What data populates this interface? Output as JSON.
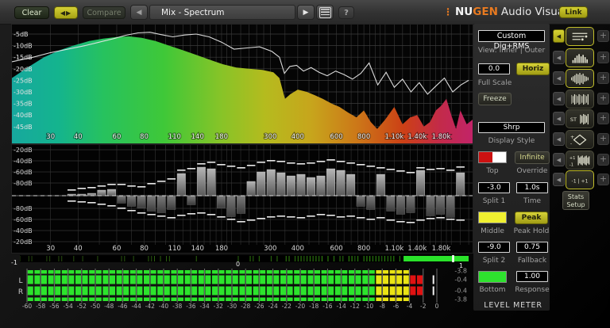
{
  "toolbar": {
    "clear": "Clear",
    "swap_icon": "◀▶",
    "compare": "Compare",
    "prev_icon": "◀",
    "preset": "Mix - Spectrum",
    "play_icon": "▶",
    "help": "?",
    "brand": {
      "dots": "⋮",
      "nu": "NU",
      "gen": "GEN",
      "rest": "Audio Visualizer"
    },
    "link": "Link"
  },
  "colors": {
    "accent_yellow": "#c8c428",
    "brand_orange": "#e87a20"
  },
  "spectrum": {
    "fmin": 20,
    "fmax": 2500,
    "y_labels": [
      "-5dB",
      "-10dB",
      "-15dB",
      "-20dB",
      "-25dB",
      "-30dB",
      "-35dB",
      "-40dB",
      "-45dB"
    ],
    "x_labels": [
      [
        30,
        "30"
      ],
      [
        40,
        "40"
      ],
      [
        60,
        "60"
      ],
      [
        80,
        "80"
      ],
      [
        110,
        "110"
      ],
      [
        140,
        "140"
      ],
      [
        180,
        "180"
      ],
      [
        300,
        "300"
      ],
      [
        400,
        "400"
      ],
      [
        600,
        "600"
      ],
      [
        800,
        "800"
      ],
      [
        1100,
        "1.10k"
      ],
      [
        1400,
        "1.40k"
      ],
      [
        1800,
        "1.80k"
      ]
    ],
    "grid_freqs": [
      30,
      40,
      50,
      60,
      70,
      80,
      90,
      100,
      110,
      120,
      130,
      140,
      150,
      160,
      170,
      180,
      190,
      200,
      220,
      240,
      260,
      280,
      300,
      350,
      400,
      450,
      500,
      550,
      600,
      650,
      700,
      750,
      800,
      850,
      900,
      950,
      1000,
      1100,
      1200,
      1300,
      1400,
      1500,
      1600,
      1700,
      1800,
      1900,
      2000,
      2200,
      2400
    ],
    "gradient": [
      [
        0,
        "#17a89e"
      ],
      [
        0.1,
        "#14b48e"
      ],
      [
        0.2,
        "#27c25e"
      ],
      [
        0.33,
        "#3fc838"
      ],
      [
        0.45,
        "#85c428"
      ],
      [
        0.55,
        "#b5bb1e"
      ],
      [
        0.65,
        "#c7a51c"
      ],
      [
        0.75,
        "#cc7718"
      ],
      [
        0.85,
        "#cc4016"
      ],
      [
        0.93,
        "#c32a4a"
      ],
      [
        1,
        "#c22468"
      ]
    ],
    "inner": [
      [
        20,
        -24
      ],
      [
        24,
        -19
      ],
      [
        28,
        -15
      ],
      [
        33,
        -12
      ],
      [
        38,
        -10
      ],
      [
        45,
        -8
      ],
      [
        52,
        -7
      ],
      [
        60,
        -6.3
      ],
      [
        68,
        -6
      ],
      [
        78,
        -6.6
      ],
      [
        90,
        -8
      ],
      [
        104,
        -10
      ],
      [
        120,
        -12
      ],
      [
        138,
        -14
      ],
      [
        158,
        -16
      ],
      [
        182,
        -18
      ],
      [
        210,
        -19.5
      ],
      [
        240,
        -20
      ],
      [
        276,
        -20.5
      ],
      [
        310,
        -21.5
      ],
      [
        330,
        -24
      ],
      [
        350,
        -33
      ],
      [
        370,
        -31
      ],
      [
        400,
        -29
      ],
      [
        440,
        -30
      ],
      [
        480,
        -31.5
      ],
      [
        520,
        -33
      ],
      [
        570,
        -35
      ],
      [
        620,
        -36.5
      ],
      [
        680,
        -39
      ],
      [
        740,
        -41
      ],
      [
        800,
        -38
      ],
      [
        860,
        -43
      ],
      [
        920,
        -46
      ],
      [
        1000,
        -42
      ],
      [
        1100,
        -36.5
      ],
      [
        1200,
        -44
      ],
      [
        1300,
        -41
      ],
      [
        1400,
        -40
      ],
      [
        1500,
        -45
      ],
      [
        1600,
        -43
      ],
      [
        1700,
        -38
      ],
      [
        1800,
        -36
      ],
      [
        1900,
        -33
      ],
      [
        2000,
        -40
      ],
      [
        2100,
        -46
      ],
      [
        2200,
        -38
      ],
      [
        2350,
        -44
      ],
      [
        2500,
        -42
      ]
    ],
    "outer": [
      [
        20,
        -17
      ],
      [
        25,
        -15
      ],
      [
        30,
        -13
      ],
      [
        36,
        -11.5
      ],
      [
        43,
        -10
      ],
      [
        50,
        -8.5
      ],
      [
        58,
        -7
      ],
      [
        66,
        -5.5
      ],
      [
        75,
        -4.5
      ],
      [
        85,
        -4.2
      ],
      [
        95,
        -5.2
      ],
      [
        108,
        -6.2
      ],
      [
        122,
        -5.4
      ],
      [
        138,
        -5
      ],
      [
        158,
        -6.2
      ],
      [
        180,
        -8.5
      ],
      [
        205,
        -11.5
      ],
      [
        235,
        -11
      ],
      [
        268,
        -10.5
      ],
      [
        305,
        -12.5
      ],
      [
        330,
        -15
      ],
      [
        348,
        -22
      ],
      [
        368,
        -19
      ],
      [
        395,
        -18.5
      ],
      [
        425,
        -21
      ],
      [
        460,
        -19.5
      ],
      [
        500,
        -21.5
      ],
      [
        545,
        -23
      ],
      [
        595,
        -21
      ],
      [
        650,
        -22.5
      ],
      [
        710,
        -24.5
      ],
      [
        775,
        -22
      ],
      [
        845,
        -17.5
      ],
      [
        925,
        -27
      ],
      [
        1010,
        -21.5
      ],
      [
        1100,
        -28
      ],
      [
        1200,
        -24.5
      ],
      [
        1310,
        -30
      ],
      [
        1430,
        -26
      ],
      [
        1560,
        -31
      ],
      [
        1700,
        -27.5
      ],
      [
        1860,
        -24
      ],
      [
        2030,
        -30
      ],
      [
        2210,
        -27
      ],
      [
        2400,
        -25
      ]
    ]
  },
  "mid": {
    "y_labels_top": [
      "-20dB",
      "-40dB",
      "-60dB",
      "-80dB"
    ],
    "y_labels_bottom": [
      "-80dB",
      "-60dB",
      "-40dB",
      "-20dB"
    ],
    "bars": [
      [
        2,
        0,
        8,
        6
      ],
      [
        2,
        0,
        10,
        7
      ],
      [
        3,
        0,
        11,
        8
      ],
      [
        7,
        0,
        13,
        10
      ],
      [
        8,
        0,
        15,
        12
      ],
      [
        0,
        9,
        15,
        15
      ],
      [
        0,
        13,
        13,
        18
      ],
      [
        0,
        15,
        12,
        21
      ],
      [
        0,
        19,
        16,
        23
      ],
      [
        0,
        21,
        19,
        25
      ],
      [
        0,
        17,
        22,
        27
      ],
      [
        28,
        0,
        33,
        24
      ],
      [
        0,
        11,
        35,
        22
      ],
      [
        36,
        0,
        41,
        21
      ],
      [
        34,
        0,
        43,
        23
      ],
      [
        0,
        15,
        40,
        26
      ],
      [
        0,
        26,
        38,
        29
      ],
      [
        0,
        22,
        36,
        32
      ],
      [
        18,
        0,
        39,
        30
      ],
      [
        30,
        0,
        43,
        28
      ],
      [
        33,
        0,
        45,
        26
      ],
      [
        29,
        0,
        44,
        25
      ],
      [
        25,
        0,
        42,
        26
      ],
      [
        27,
        0,
        41,
        27
      ],
      [
        23,
        0,
        42,
        25
      ],
      [
        25,
        0,
        44,
        23
      ],
      [
        34,
        0,
        46,
        24
      ],
      [
        32,
        0,
        44,
        26
      ],
      [
        27,
        0,
        42,
        25
      ],
      [
        0,
        13,
        40,
        27
      ],
      [
        0,
        17,
        38,
        29
      ],
      [
        27,
        0,
        36,
        27
      ],
      [
        0,
        19,
        34,
        30
      ],
      [
        0,
        23,
        32,
        32
      ],
      [
        0,
        21,
        30,
        33
      ],
      [
        32,
        0,
        36,
        30
      ],
      [
        0,
        25,
        34,
        28
      ],
      [
        0,
        23,
        35,
        27
      ],
      [
        0,
        27,
        33,
        29
      ],
      [
        29,
        0,
        37,
        30
      ]
    ]
  },
  "correlation": {
    "left_label": "-1",
    "mid_label": "0",
    "right_label": "1",
    "solid_from": 0.855,
    "marker_at": 0.965
  },
  "meter": {
    "channel_labels": [
      "L",
      "R"
    ],
    "scale": [
      "-60",
      "-58",
      "-56",
      "-54",
      "-52",
      "-50",
      "-48",
      "-46",
      "-44",
      "-42",
      "-40",
      "-38",
      "-36",
      "-34",
      "-32",
      "-30",
      "-28",
      "-26",
      "-24",
      "-22",
      "-20",
      "-18",
      "-16",
      "-14",
      "-12",
      "-10",
      "-8",
      "-6",
      "-4",
      "-2",
      "0"
    ],
    "values": [
      "-3.8",
      "-0.4",
      "-0.4",
      "-3.8"
    ],
    "colors": {
      "green": "#2ce42c",
      "yellow": "#eae414",
      "red": "#e01212"
    }
  },
  "sidebar": {
    "preset": "Custom Dig+RMS",
    "view_label": "View: Inner | Outer",
    "full_scale_value": "0.0",
    "horiz_button": "Horiz",
    "full_scale_label": "Full Scale",
    "freeze_button": "Freeze",
    "display_style_value": "Shrp",
    "display_style_label": "Display Style",
    "top_label": "Top",
    "override_button": "Infinite",
    "override_label": "Override",
    "split1_value": "-3.0",
    "split1_label": "Split 1",
    "time_value": "1.0s",
    "time_label": "Time",
    "middle_label": "Middle",
    "peak_hold_button": "Peak",
    "peak_hold_label": "Peak Hold",
    "split2_value": "-9.0",
    "split2_label": "Split 2",
    "fallback_value": "0.75",
    "fallback_label": "Fallback",
    "bottom_label": "Bottom",
    "response_value": "1.00",
    "response_label": "Response",
    "section_label": "LEVEL METER",
    "stats_line1": "Stats",
    "stats_line2": "Setup",
    "swatches": {
      "top_left": "#cc1111",
      "top_right": "#ffffff",
      "middle": "#f0f030",
      "bottom": "#2ee22e"
    }
  },
  "modules": [
    {
      "name": "level-meter",
      "icon": "lines",
      "active": true,
      "arrow_active": true
    },
    {
      "name": "spectrum",
      "icon": "bars",
      "active": true,
      "arrow_active": false
    },
    {
      "name": "waveform",
      "icon": "wave",
      "active": true,
      "arrow_active": false
    },
    {
      "name": "spectrogram",
      "icon": "dense",
      "active": false,
      "arrow_active": false
    },
    {
      "name": "stereo-spectrogram",
      "icon": "stdense",
      "active": false,
      "arrow_active": false,
      "label": "ST"
    },
    {
      "name": "vectorscope",
      "icon": "diamond",
      "active": false,
      "arrow_active": false
    },
    {
      "name": "correlation-history",
      "icon": "corrhist",
      "active": false,
      "arrow_active": false
    },
    {
      "name": "correlation-meter",
      "icon": "corrtext",
      "active": true,
      "arrow_active": false,
      "label": "-1 | +1"
    }
  ]
}
